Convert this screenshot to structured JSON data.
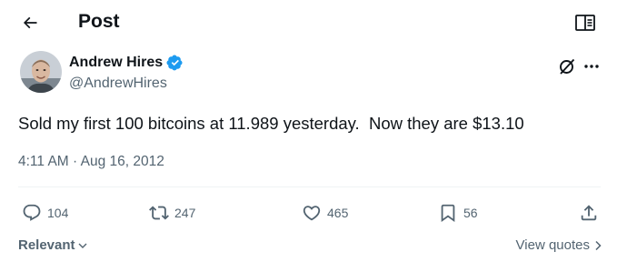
{
  "header": {
    "title": "Post",
    "back_icon": "arrow-left-icon",
    "reader_icon": "reader-mode-icon"
  },
  "author": {
    "name": "Andrew Hires",
    "handle": "@AndrewHires",
    "verified": true,
    "verified_color": "#1d9bf0"
  },
  "tweet": {
    "text": "Sold my first 100 bitcoins at 11.989 yesterday.  Now they are $13.10",
    "time": "4:11 AM",
    "separator": "·",
    "date": "Aug 16, 2012"
  },
  "actions": {
    "replies": "104",
    "reposts": "247",
    "likes": "465",
    "bookmarks": "56"
  },
  "footer": {
    "sort_label": "Relevant",
    "view_quotes_label": "View quotes"
  },
  "colors": {
    "text_primary": "#0f1419",
    "text_secondary": "#536471",
    "accent": "#1d9bf0",
    "divider": "#eff3f4"
  }
}
